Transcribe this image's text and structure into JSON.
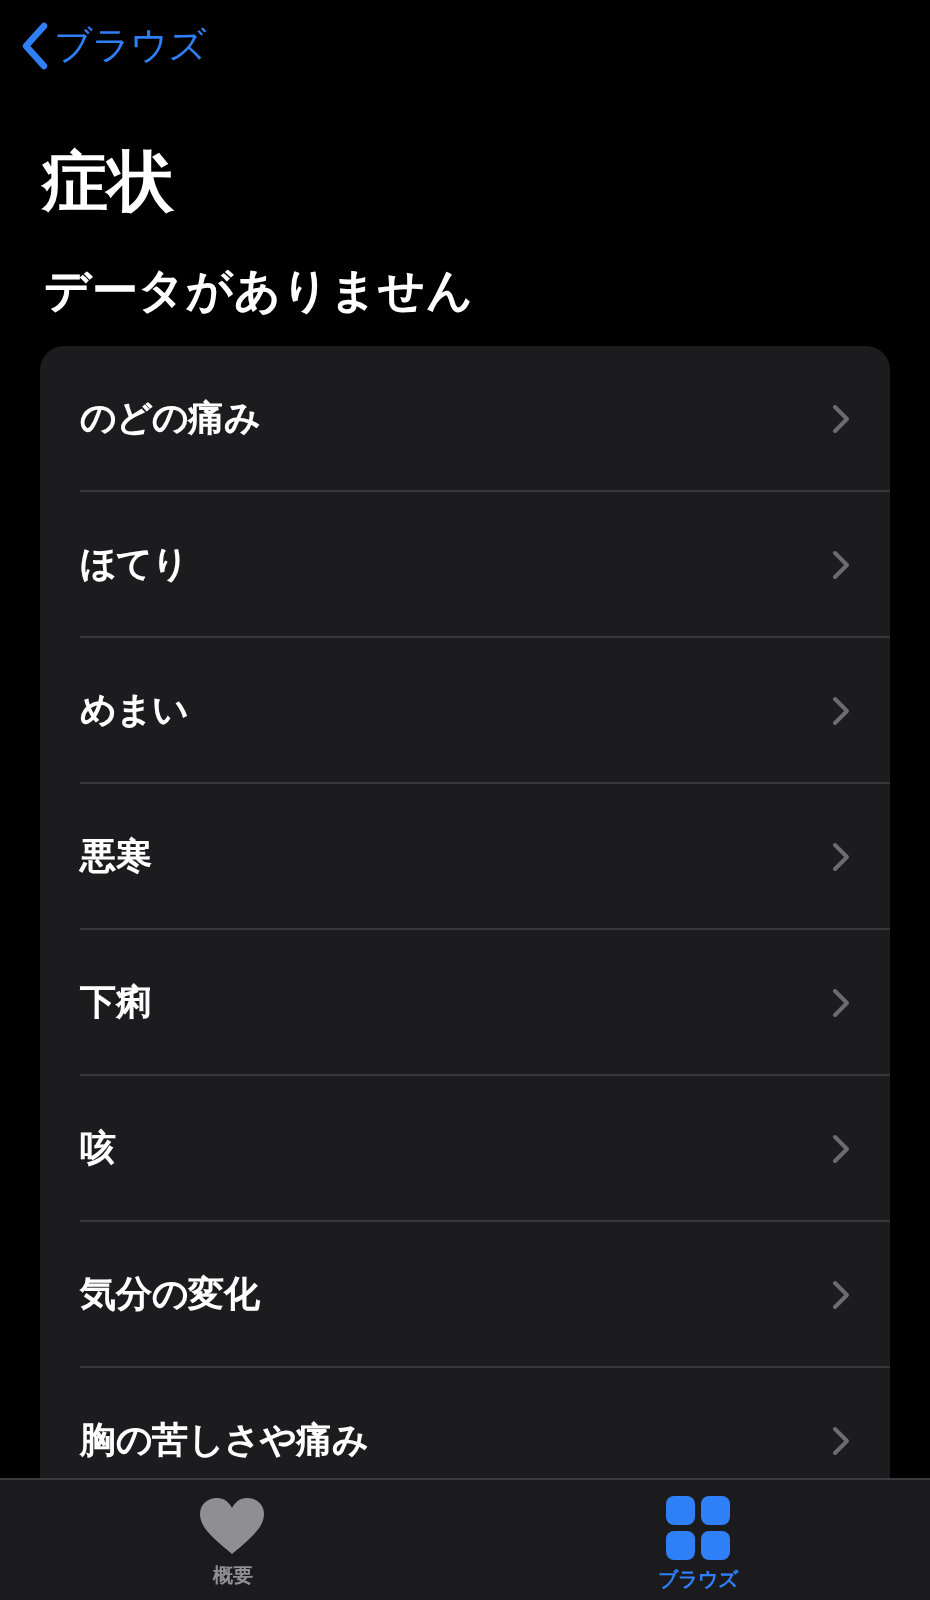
{
  "nav": {
    "back_label": "ブラウズ"
  },
  "title": "症状",
  "section_header": "データがありません",
  "items": [
    {
      "label": "のどの痛み"
    },
    {
      "label": "ほてり"
    },
    {
      "label": "めまい"
    },
    {
      "label": "悪寒"
    },
    {
      "label": "下痢"
    },
    {
      "label": "咳"
    },
    {
      "label": "気分の変化"
    },
    {
      "label": "胸の苦しさや痛み"
    }
  ],
  "tab_bar": [
    {
      "label": "概要",
      "kind": "heart",
      "selected": false
    },
    {
      "label": "ブラウズ",
      "kind": "grid",
      "selected": true
    }
  ]
}
